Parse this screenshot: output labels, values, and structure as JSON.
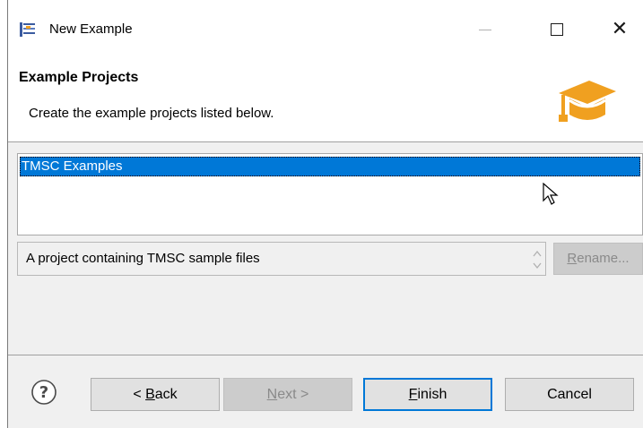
{
  "window": {
    "title": "New Example",
    "app_icon": "wizard-icon",
    "controls": {
      "minimize": "minimize-icon",
      "maximize": "maximize-icon",
      "close": "close-icon"
    }
  },
  "banner": {
    "title": "Example Projects",
    "description": "Create the example projects listed below.",
    "icon": "graduation-cap-icon",
    "icon_color": "#f0a020"
  },
  "projects": {
    "items": [
      {
        "label": "TMSC Examples",
        "selected": true
      }
    ],
    "selection_color": "#0078d7"
  },
  "description_field": {
    "value": "A project containing TMSC sample files"
  },
  "buttons": {
    "rename": {
      "mnemonic": "R",
      "rest": "ename...",
      "enabled": false
    },
    "back": {
      "prefix": "< ",
      "mnemonic": "B",
      "rest": "ack",
      "enabled": true
    },
    "next": {
      "mnemonic": "N",
      "rest": "ext >",
      "enabled": false
    },
    "finish": {
      "mnemonic": "F",
      "rest": "inish",
      "enabled": true,
      "default": true
    },
    "cancel": {
      "label": "Cancel",
      "enabled": true
    },
    "help_icon": "help-icon"
  }
}
